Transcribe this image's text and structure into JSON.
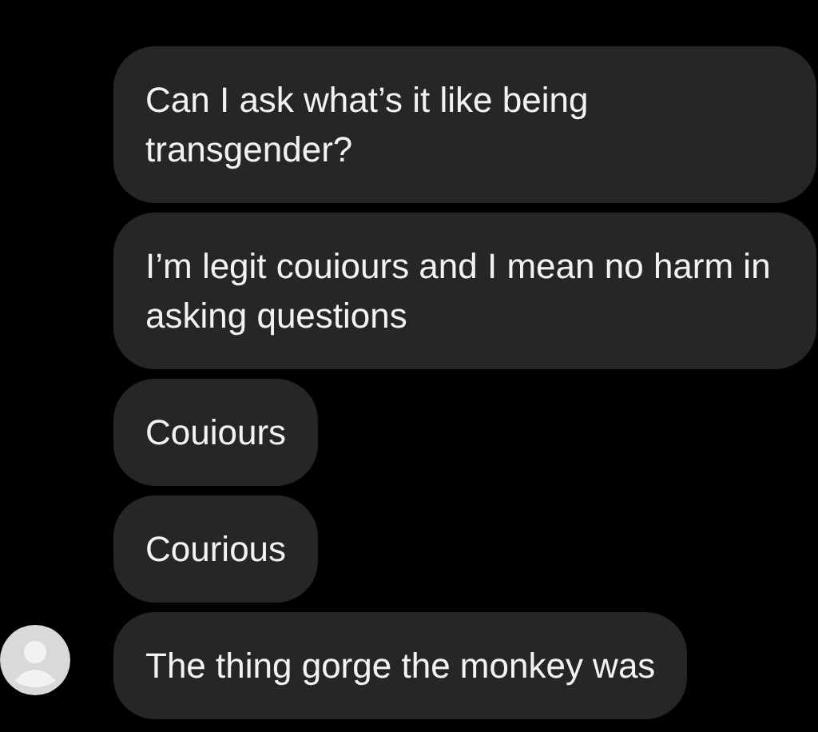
{
  "messages": [
    {
      "text": "Can I ask what’s it like being transgender?"
    },
    {
      "text": "I’m legit couiours and I mean no harm in asking questions"
    },
    {
      "text": "Couiours"
    },
    {
      "text": "Courious"
    },
    {
      "text": "The thing gorge the monkey was"
    }
  ]
}
